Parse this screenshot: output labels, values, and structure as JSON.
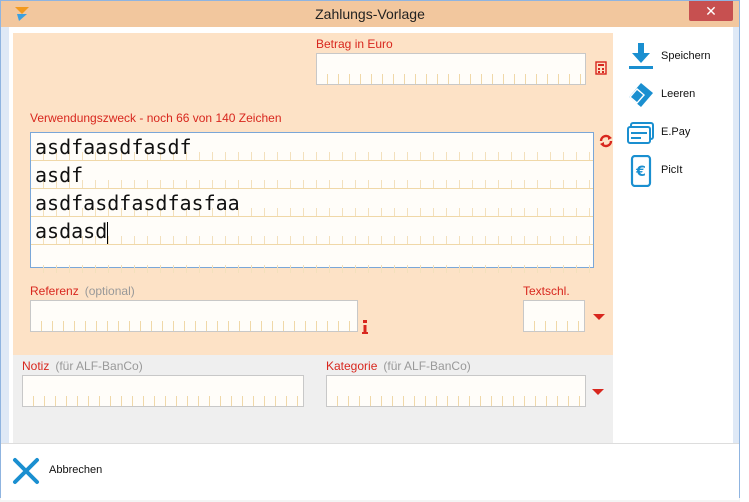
{
  "window": {
    "title": "Zahlungs-Vorlage",
    "close_label": "✕"
  },
  "amount": {
    "label": "Betrag in Euro",
    "value": ""
  },
  "purpose": {
    "label": "Verwendungszweck - noch 66 von 140 Zeichen",
    "lines": [
      "asdfaasdfasdf",
      "asdf",
      "asdfasdfasdfasfaa",
      "asdasd",
      ""
    ]
  },
  "reference": {
    "label": "Referenz",
    "hint": "(optional)",
    "value": ""
  },
  "textschl": {
    "label": "Textschl.",
    "value": ""
  },
  "note": {
    "label": "Notiz",
    "hint": "(für ALF-BanCo)",
    "value": ""
  },
  "category": {
    "label": "Kategorie",
    "hint": "(für ALF-BanCo)",
    "value": ""
  },
  "actions": {
    "save": "Speichern",
    "clear": "Leeren",
    "epay": "E.Pay",
    "picit": "PicIt"
  },
  "footer": {
    "cancel": "Abbrechen"
  },
  "colors": {
    "accent_red": "#d8271e",
    "icon_blue": "#1a8fd0",
    "form_bg": "#fde2c6"
  }
}
